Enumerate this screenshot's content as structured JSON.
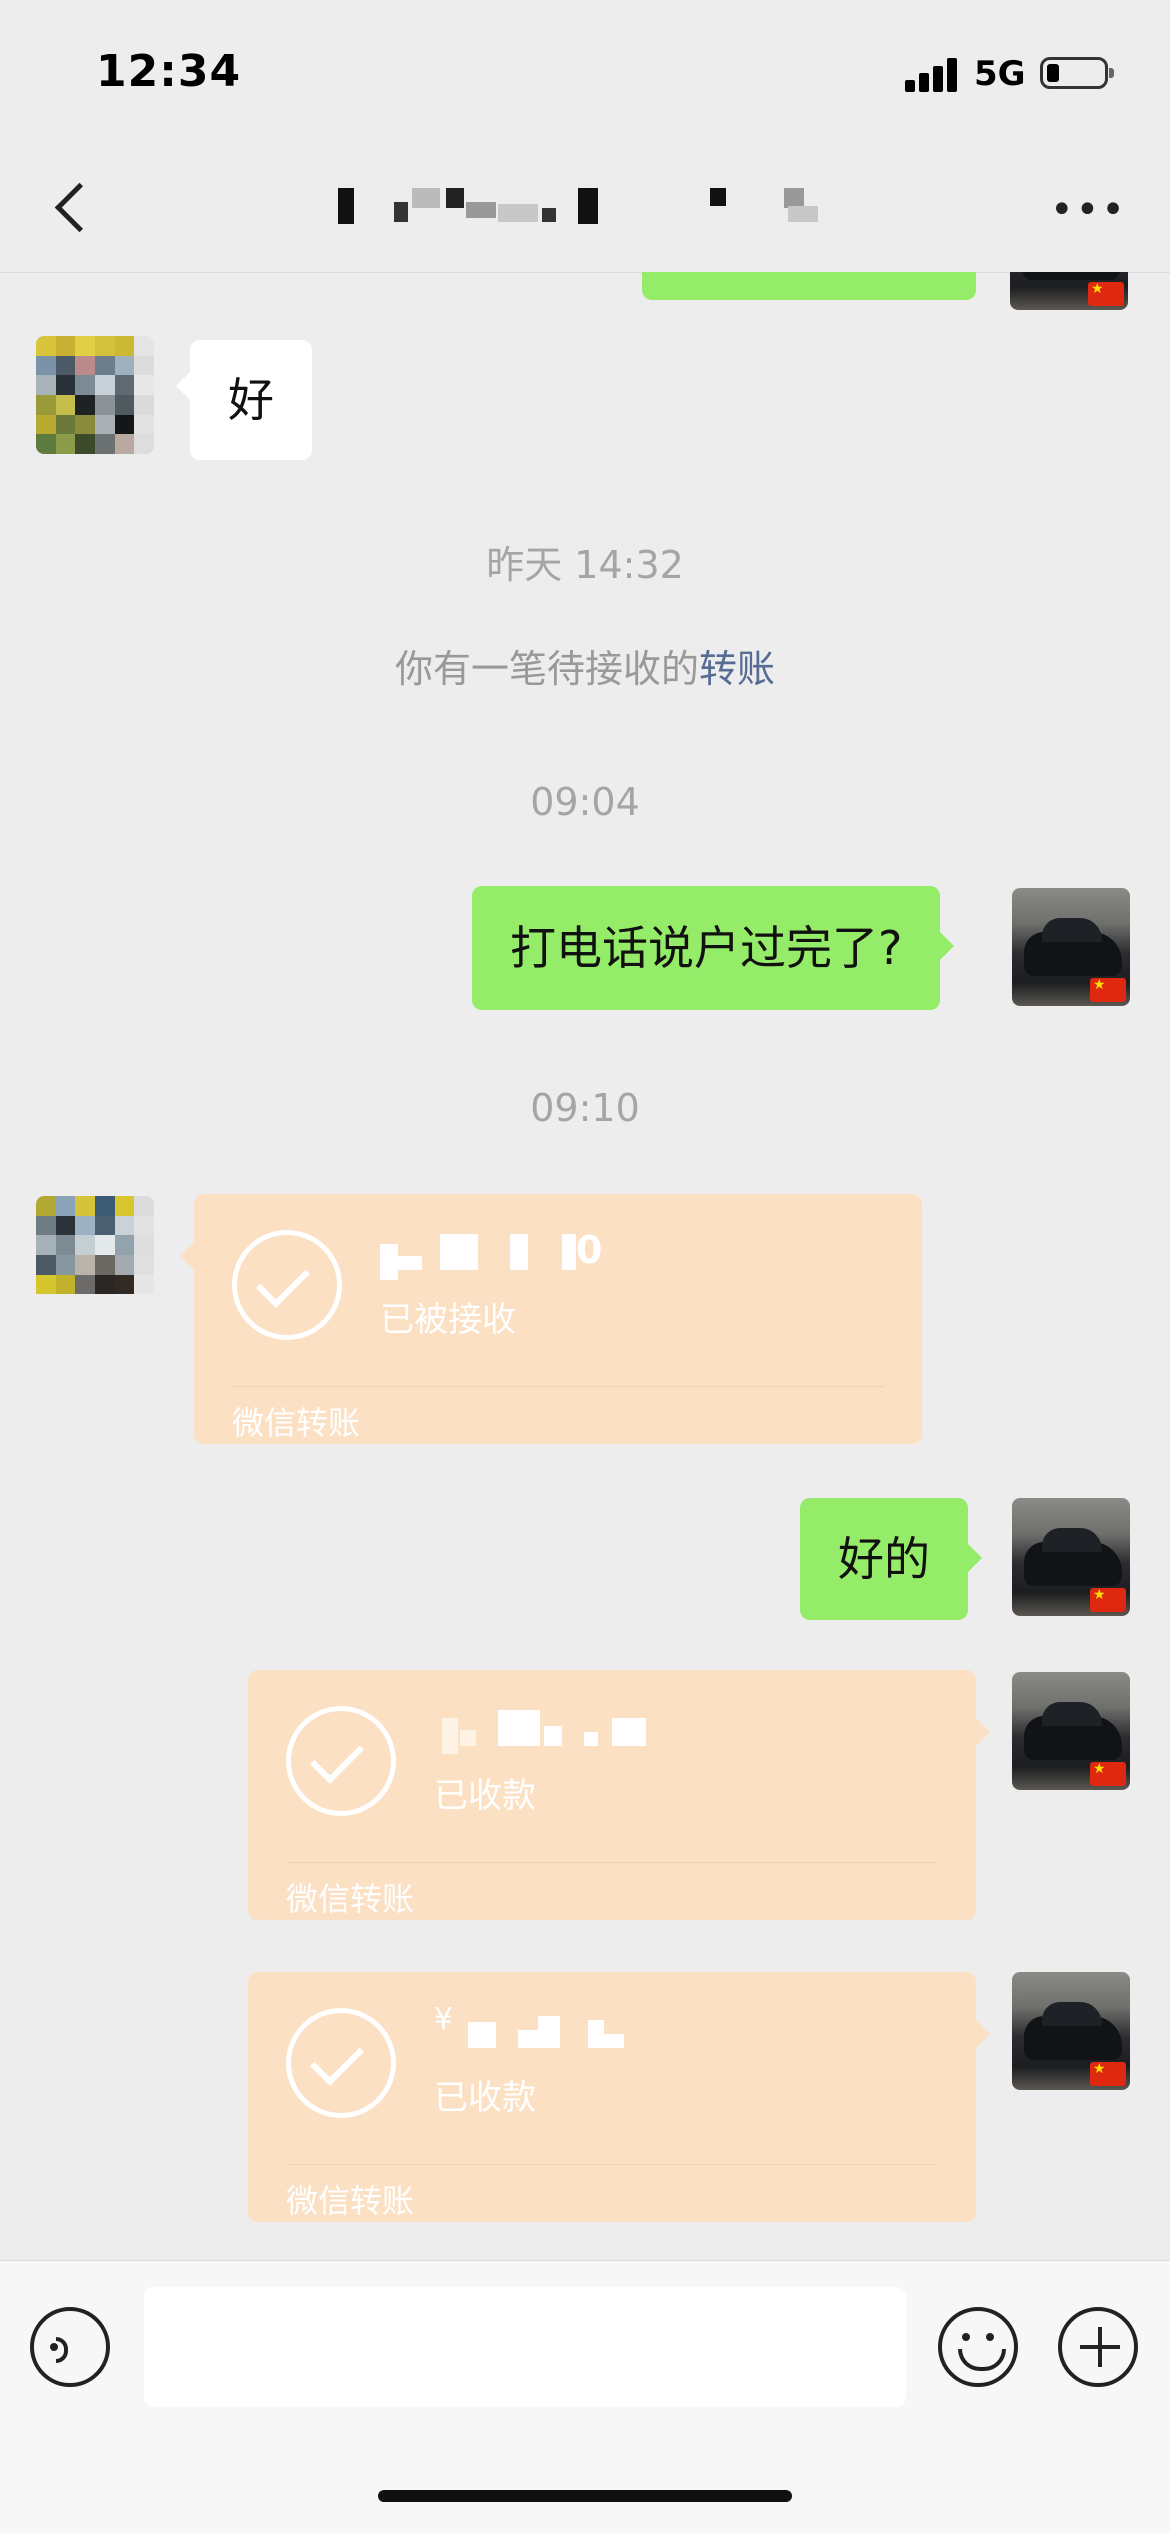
{
  "status_bar": {
    "time": "12:34",
    "network": "5G"
  },
  "nav": {
    "title": ""
  },
  "messages": {
    "incoming_1": "好",
    "timestamp_1": "昨天 14:32",
    "system_notice_prefix": "你有一笔待接收的",
    "system_notice_link": "转账",
    "timestamp_2": "09:04",
    "outgoing_1": "打电话说户过完了?",
    "timestamp_3": "09:10",
    "outgoing_2": "好的"
  },
  "transfers": [
    {
      "direction": "incoming",
      "status": "已被接收",
      "footer": "微信转账"
    },
    {
      "direction": "outgoing",
      "status": "已收款",
      "footer": "微信转账"
    },
    {
      "direction": "outgoing",
      "status": "已收款",
      "footer": "微信转账"
    }
  ],
  "input": {
    "value": "",
    "placeholder": ""
  },
  "colors": {
    "background": "#ededed",
    "outgoing_bubble": "#95ec69",
    "incoming_bubble": "#ffffff",
    "transfer_card": "#fce0c4",
    "link": "#576b95"
  },
  "icons": [
    "back-icon",
    "more-icon",
    "check-icon",
    "voice-icon",
    "emoji-icon",
    "plus-icon",
    "signal-icon",
    "battery-icon"
  ]
}
